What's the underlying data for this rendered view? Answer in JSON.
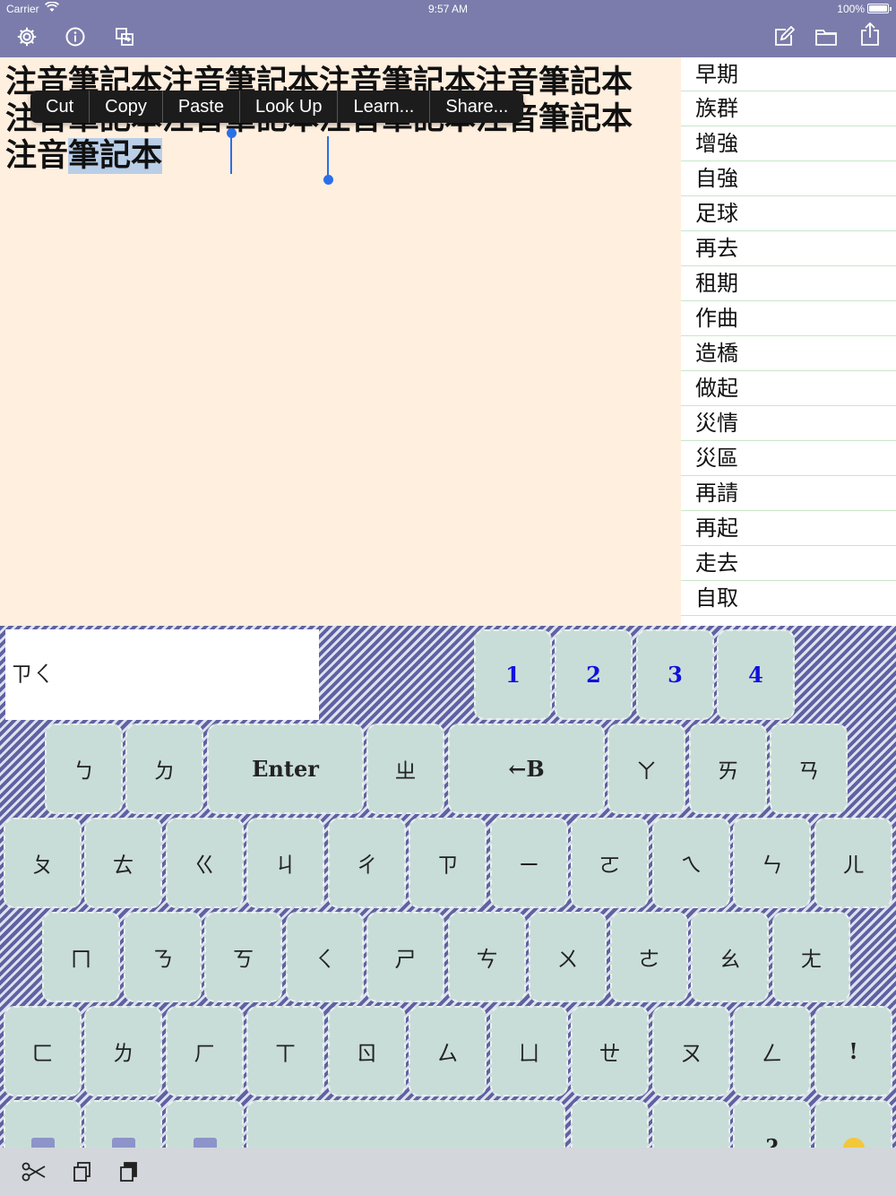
{
  "status": {
    "carrier": "Carrier",
    "time": "9:57 AM",
    "battery": "100%"
  },
  "toolbar": {
    "icons": [
      "gear-icon",
      "info-icon",
      "switch-icon",
      "compose-icon",
      "folder-icon",
      "share-icon"
    ]
  },
  "editor": {
    "text_before": "注音筆記本注音筆記本注音筆記本注音筆記本注音筆記本注音筆記本注音筆記本注音筆記本注音",
    "selected_text": "筆記本",
    "context_menu": [
      "Cut",
      "Copy",
      "Paste",
      "Look Up",
      "Learn...",
      "Share..."
    ]
  },
  "candidates": [
    "早期",
    "族群",
    "增強",
    "自強",
    "足球",
    "再去",
    "租期",
    "作曲",
    "造橋",
    "做起",
    "災情",
    "災區",
    "再請",
    "再起",
    "走去",
    "自取"
  ],
  "keyboard": {
    "composition": "ㄗㄑ",
    "numbers": [
      "1",
      "2",
      "3",
      "4"
    ],
    "row1": [
      "ㄅ",
      "ㄉ",
      "Enter",
      "ㄓ",
      "←B",
      "ㄚ",
      "ㄞ",
      "ㄢ"
    ],
    "row2": [
      "ㄆ",
      "ㄊ",
      "ㄍ",
      "ㄐ",
      "ㄔ",
      "ㄗ",
      "ㄧ",
      "ㄛ",
      "ㄟ",
      "ㄣ",
      "ㄦ"
    ],
    "row3": [
      "ㄇ",
      "ㄋ",
      "ㄎ",
      "ㄑ",
      "ㄕ",
      "ㄘ",
      "ㄨ",
      "ㄜ",
      "ㄠ",
      "ㄤ"
    ],
    "row4": [
      "ㄈ",
      "ㄌ",
      "ㄏ",
      "ㄒ",
      "ㄖ",
      "ㄙ",
      "ㄩ",
      "ㄝ",
      "ㄡ",
      "ㄥ",
      "!"
    ],
    "row5_visible": [
      "?"
    ]
  },
  "bottombar": {
    "icons": [
      "scissors-icon",
      "copy-icon",
      "paste-icon"
    ]
  }
}
